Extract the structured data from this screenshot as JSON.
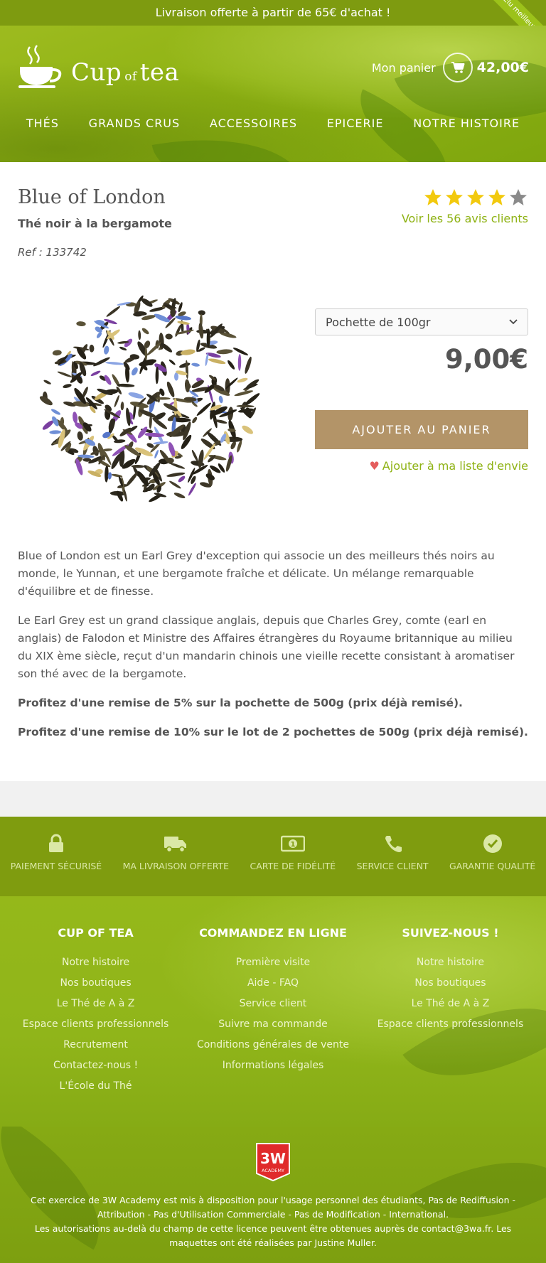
{
  "topbar": {
    "announcement": "Livraison offerte à partir de 65€ d'achat !",
    "ribbon": "Élu meilleur thé"
  },
  "header": {
    "logo_main": "Cup",
    "logo_of": "of",
    "logo_end": "tea",
    "cart_label": "Mon panier",
    "cart_total": "42,00€",
    "nav": [
      "THÉS",
      "GRANDS CRUS",
      "ACCESSOIRES",
      "EPICERIE",
      "NOTRE HISTOIRE"
    ]
  },
  "product": {
    "title": "Blue of London",
    "subtitle": "Thé noir à la bergamote",
    "ref": "Ref : 133742",
    "rating": 4,
    "rating_max": 5,
    "reviews_link": "Voir les 56 avis clients",
    "select_value": "Pochette de 100gr",
    "price": "9,00€",
    "add_to_cart": "AJOUTER AU PANIER",
    "wishlist": "Ajouter à ma liste d'envie",
    "description": [
      "Blue of London est un Earl Grey d'exception qui associe un des meilleurs thés noirs au monde, le Yunnan, et une bergamote fraîche et délicate. Un mélange remarquable d'équilibre et de finesse.",
      "Le Earl Grey est un grand classique anglais, depuis que Charles Grey, comte (earl en anglais) de Falodon et Ministre des Affaires étrangères du Royaume britannique au milieu du XIX ème siècle, reçut d'un mandarin chinois une vieille recette consistant à aromatiser son thé avec de la bergamote.",
      "Profitez d'une remise de 5% sur la pochette de 500g (prix déjà remisé).",
      "Profitez d'une remise de 10% sur le lot de 2 pochettes de 500g (prix déjà remisé)."
    ]
  },
  "features": [
    {
      "label": "PAIEMENT SÉCURISÉ",
      "icon": "lock-icon"
    },
    {
      "label": "MA LIVRAISON OFFERTE",
      "icon": "truck-icon"
    },
    {
      "label": "CARTE DE FIDÉLITÉ",
      "icon": "card-icon"
    },
    {
      "label": "SERVICE CLIENT",
      "icon": "phone-icon"
    },
    {
      "label": "GARANTIE QUALITÉ",
      "icon": "check-icon"
    }
  ],
  "footer": {
    "columns": [
      {
        "title": "CUP OF TEA",
        "links": [
          "Notre histoire",
          "Nos boutiques",
          "Le Thé de A à Z",
          "Espace clients professionnels",
          "Recrutement",
          "Contactez-nous !",
          "L'École du Thé"
        ]
      },
      {
        "title": "COMMANDEZ EN LIGNE",
        "links": [
          "Première visite",
          "Aide - FAQ",
          "Service client",
          "Suivre ma commande",
          "Conditions générales de vente",
          "Informations légales"
        ]
      },
      {
        "title": "SUIVEZ-NOUS !",
        "links": [
          "Notre histoire",
          "Nos boutiques",
          "Le Thé de A à Z",
          "Espace clients professionnels"
        ]
      }
    ],
    "academy_logo_text": "3W",
    "academy_logo_sub": "ACADEMY",
    "legal_line1": "Cet exercice de 3W Academy est mis à disposition pour l'usage personnel des étudiants, Pas de Rediffusion - Attribution - Pas d'Utilisation Commerciale - Pas de Modification - International.",
    "legal_line2": "Les autorisations au-delà du champ de cette licence peuvent être obtenues auprès de contact@3wa.fr. Les maquettes ont été réalisées par Justine Muller."
  },
  "colors": {
    "brand_green": "#8eb213",
    "dark_green": "#7f9c0f",
    "button_brown": "#b39468",
    "star_yellow": "#f2c90e",
    "star_grey": "#8a8a8a",
    "heart_red": "#e45d5d"
  }
}
